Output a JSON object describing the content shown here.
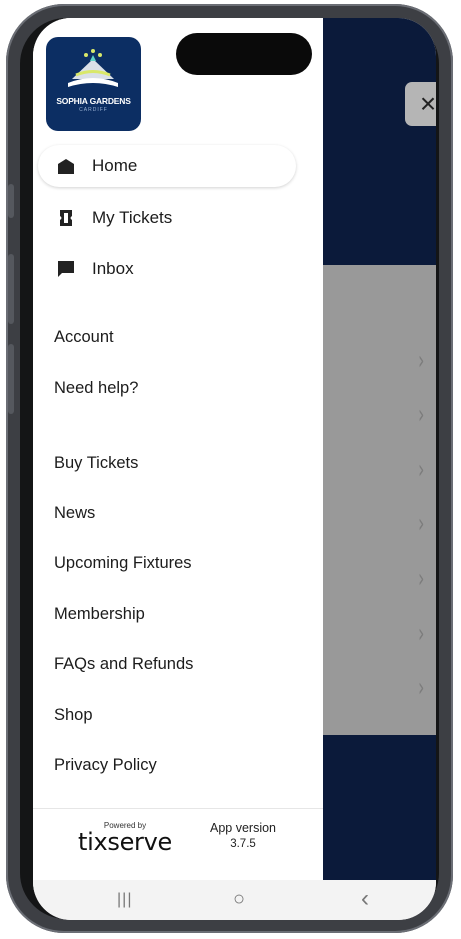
{
  "logo": {
    "line1": "SOPHIA GARDENS",
    "line2": "CARDIFF"
  },
  "nav": [
    {
      "label": "Home",
      "icon": "home-icon",
      "active": true
    },
    {
      "label": "My Tickets",
      "icon": "ticket-icon",
      "active": false
    },
    {
      "label": "Inbox",
      "icon": "chat-icon",
      "active": false
    }
  ],
  "links": [
    "Account",
    "Need help?",
    "Buy Tickets",
    "News",
    "Upcoming Fixtures",
    "Membership",
    "FAQs and Refunds",
    "Shop",
    "Privacy Policy"
  ],
  "footer": {
    "powered_by": "Powered by",
    "brand": "tixserve",
    "version_label": "App version",
    "version": "3.7.5"
  },
  "close_icon": "×",
  "chevron": "›",
  "system_nav": {
    "recents": "|||",
    "home": "○",
    "back": "‹"
  },
  "colors": {
    "backdrop": "#0b1a3a",
    "logo_bg": "#0c2e63",
    "overlay": "#999999"
  }
}
